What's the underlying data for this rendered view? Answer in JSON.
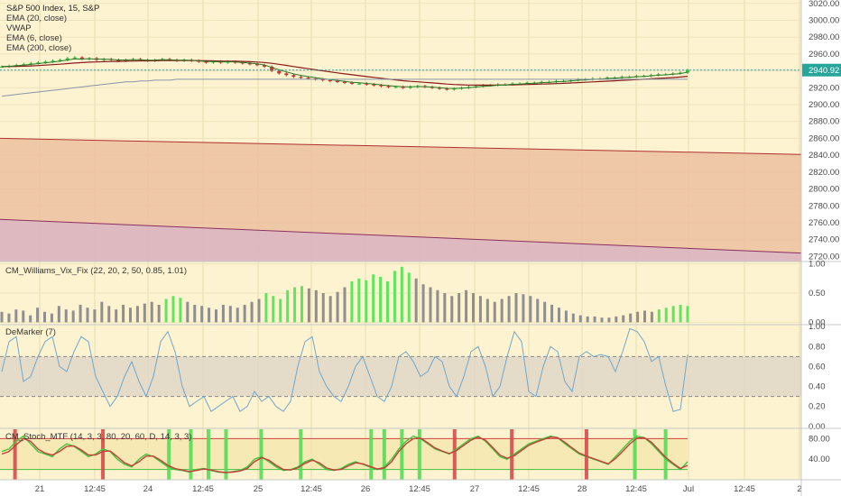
{
  "chart_data": [
    {
      "type": "candlestick",
      "title": "S&P 500 Index, 15, S&P",
      "indicators": [
        "EMA (20, close)",
        "VWAP",
        "EMA (6, close)",
        "EMA (200, close)"
      ],
      "y_ticks": [
        2720,
        2740,
        2760,
        2780,
        2800,
        2820,
        2840,
        2860,
        2880,
        2900,
        2920,
        2940,
        2960,
        2980,
        3000,
        3020
      ],
      "y_tick_labels": [
        "2720.00",
        "2740.00",
        "2760.00",
        "2780.00",
        "2800.00",
        "2820.00",
        "2840.00",
        "2860.00",
        "2880.00",
        "2900.00",
        "2920.00",
        "2940.00",
        "2960.00",
        "2980.00",
        "3000.00",
        "3020.00"
      ],
      "ylim": [
        2714,
        3024
      ],
      "last_price": 2940.92,
      "last_price_label": "2940.92",
      "close": [
        2945,
        2946,
        2947,
        2948,
        2949,
        2950,
        2951,
        2952,
        2953,
        2955,
        2956,
        2954,
        2955,
        2953,
        2954,
        2953,
        2952,
        2953,
        2954,
        2953,
        2952,
        2953,
        2954,
        2953,
        2952,
        2953,
        2952,
        2951,
        2950,
        2951,
        2950,
        2951,
        2950,
        2949,
        2948,
        2947,
        2945,
        2940,
        2937,
        2935,
        2933,
        2932,
        2931,
        2930,
        2929,
        2928,
        2927,
        2926,
        2925,
        2925,
        2924,
        2923,
        2922,
        2921,
        2921,
        2920,
        2921,
        2922,
        2921,
        2920,
        2919,
        2918,
        2919,
        2920,
        2921,
        2922,
        2923,
        2923,
        2924,
        2924,
        2925,
        2925,
        2926,
        2926,
        2927,
        2927,
        2928,
        2928,
        2929,
        2930,
        2930,
        2931,
        2931,
        2932,
        2932,
        2933,
        2933,
        2934,
        2934,
        2935,
        2936,
        2936,
        2937,
        2938,
        2941
      ],
      "ema200": [
        2910,
        2911,
        2912,
        2913,
        2914,
        2915,
        2916,
        2917,
        2918,
        2919,
        2920,
        2921,
        2922,
        2923,
        2924,
        2925,
        2926,
        2927,
        2927,
        2928,
        2928,
        2929,
        2929,
        2929,
        2930,
        2930,
        2930,
        2930,
        2930,
        2930,
        2930,
        2930,
        2930,
        2930,
        2930,
        2930,
        2930,
        2930,
        2930,
        2930,
        2930,
        2930,
        2930,
        2930,
        2930,
        2930,
        2930,
        2930,
        2930,
        2930,
        2930,
        2930,
        2930,
        2930,
        2930,
        2930,
        2930,
        2930,
        2930,
        2930,
        2930,
        2930,
        2930,
        2930,
        2930,
        2930,
        2930,
        2930,
        2930,
        2930,
        2930,
        2930,
        2930,
        2930,
        2930,
        2930,
        2930,
        2930,
        2930,
        2930,
        2930,
        2930,
        2930,
        2930,
        2930,
        2930,
        2930,
        2930,
        2930,
        2930,
        2930,
        2930,
        2930,
        2930,
        2930
      ],
      "channel_upper": {
        "start": 2860,
        "end": 2841
      },
      "channel_lower": {
        "start": 2764,
        "end": 2724
      }
    },
    {
      "type": "bar",
      "title": "CM_Williams_Vix_Fix (22, 20, 2, 50, 0.85, 1.01)",
      "y_ticks": [
        0,
        0.5,
        1
      ],
      "y_tick_labels": [
        "0.00",
        "0.50",
        "1.00"
      ],
      "ylim": [
        -0.04,
        1.04
      ],
      "values": [
        0.18,
        0.15,
        0.22,
        0.2,
        0.12,
        0.25,
        0.18,
        0.15,
        0.28,
        0.22,
        0.2,
        0.3,
        0.25,
        0.22,
        0.35,
        0.28,
        0.22,
        0.3,
        0.25,
        0.28,
        0.32,
        0.35,
        0.3,
        0.4,
        0.45,
        0.42,
        0.35,
        0.3,
        0.28,
        0.25,
        0.22,
        0.3,
        0.28,
        0.25,
        0.3,
        0.35,
        0.4,
        0.5,
        0.45,
        0.4,
        0.55,
        0.6,
        0.62,
        0.58,
        0.55,
        0.5,
        0.45,
        0.52,
        0.6,
        0.7,
        0.75,
        0.72,
        0.82,
        0.78,
        0.7,
        0.88,
        0.95,
        0.85,
        0.75,
        0.65,
        0.6,
        0.55,
        0.5,
        0.45,
        0.5,
        0.55,
        0.5,
        0.45,
        0.4,
        0.35,
        0.4,
        0.45,
        0.5,
        0.48,
        0.45,
        0.4,
        0.35,
        0.3,
        0.25,
        0.2,
        0.15,
        0.12,
        0.1,
        0.1,
        0.08,
        0.08,
        0.1,
        0.12,
        0.15,
        0.18,
        0.2,
        0.18,
        0.22,
        0.25,
        0.28,
        0.3,
        0.28
      ],
      "highlight": [
        false,
        false,
        false,
        false,
        false,
        false,
        false,
        false,
        false,
        false,
        false,
        false,
        false,
        false,
        false,
        false,
        false,
        false,
        false,
        false,
        false,
        false,
        false,
        true,
        true,
        true,
        false,
        false,
        false,
        false,
        false,
        false,
        false,
        false,
        false,
        false,
        false,
        true,
        true,
        true,
        true,
        true,
        true,
        false,
        false,
        false,
        false,
        false,
        false,
        true,
        true,
        true,
        true,
        true,
        true,
        true,
        true,
        true,
        false,
        false,
        false,
        false,
        false,
        false,
        false,
        false,
        false,
        false,
        false,
        false,
        false,
        false,
        false,
        false,
        false,
        false,
        false,
        false,
        false,
        false,
        false,
        false,
        false,
        false,
        false,
        false,
        false,
        false,
        false,
        false,
        false,
        false,
        true,
        true,
        true,
        true,
        true
      ]
    },
    {
      "type": "line",
      "title": "DeMarker (7)",
      "y_ticks": [
        0,
        0.2,
        0.4,
        0.6,
        0.8,
        1.0
      ],
      "y_tick_labels": [
        "0.00",
        "0.20",
        "0.40",
        "0.60",
        "0.80",
        "1.00"
      ],
      "ylim": [
        -0.02,
        1.02
      ],
      "band": [
        0.3,
        0.7
      ],
      "values": [
        0.55,
        0.85,
        0.9,
        0.45,
        0.5,
        0.7,
        0.85,
        0.9,
        0.6,
        0.55,
        0.75,
        0.9,
        0.85,
        0.5,
        0.35,
        0.2,
        0.3,
        0.5,
        0.65,
        0.45,
        0.3,
        0.5,
        0.85,
        0.95,
        0.75,
        0.4,
        0.2,
        0.25,
        0.3,
        0.15,
        0.2,
        0.25,
        0.3,
        0.15,
        0.2,
        0.35,
        0.25,
        0.3,
        0.2,
        0.15,
        0.25,
        0.6,
        0.85,
        0.9,
        0.55,
        0.4,
        0.3,
        0.25,
        0.4,
        0.6,
        0.7,
        0.5,
        0.3,
        0.25,
        0.4,
        0.7,
        0.75,
        0.65,
        0.5,
        0.55,
        0.7,
        0.65,
        0.4,
        0.3,
        0.5,
        0.75,
        0.8,
        0.6,
        0.3,
        0.4,
        0.7,
        0.95,
        0.85,
        0.35,
        0.3,
        0.6,
        0.8,
        0.75,
        0.45,
        0.35,
        0.7,
        0.75,
        0.7,
        0.72,
        0.7,
        0.55,
        0.75,
        0.98,
        0.95,
        0.85,
        0.65,
        0.7,
        0.4,
        0.15,
        0.17,
        0.72
      ]
    },
    {
      "type": "line",
      "title": "CM_Stoch_MTF (14, 3, 3, 80, 20, 60, D, 14, 3, 3)",
      "y_ticks": [
        40,
        80
      ],
      "y_tick_labels": [
        "40.00",
        "80.00"
      ],
      "ylim": [
        0,
        100
      ],
      "upper": 80,
      "lower": 20,
      "series": [
        {
          "values": [
            55,
            60,
            75,
            85,
            70,
            55,
            50,
            45,
            60,
            70,
            65,
            55,
            45,
            50,
            60,
            55,
            40,
            30,
            25,
            40,
            50,
            45,
            35,
            25,
            20,
            18,
            15,
            20,
            22,
            18,
            15,
            14,
            16,
            18,
            25,
            40,
            45,
            35,
            25,
            18,
            20,
            25,
            35,
            40,
            30,
            20,
            18,
            22,
            30,
            35,
            30,
            25,
            20,
            25,
            40,
            60,
            75,
            85,
            80,
            70,
            60,
            55,
            50,
            60,
            70,
            80,
            85,
            75,
            60,
            45,
            40,
            50,
            60,
            70,
            75,
            80,
            85,
            82,
            70,
            60,
            50,
            45,
            40,
            35,
            30,
            45,
            60,
            75,
            85,
            82,
            70,
            55,
            40,
            30,
            20,
            35
          ]
        },
        {
          "values": [
            50,
            55,
            68,
            80,
            75,
            60,
            52,
            48,
            55,
            65,
            66,
            58,
            48,
            48,
            55,
            56,
            45,
            33,
            27,
            35,
            46,
            46,
            38,
            28,
            22,
            19,
            16,
            18,
            21,
            19,
            16,
            14,
            15,
            17,
            22,
            35,
            43,
            38,
            28,
            20,
            19,
            23,
            32,
            38,
            33,
            23,
            19,
            20,
            27,
            33,
            31,
            26,
            21,
            23,
            35,
            55,
            70,
            80,
            81,
            72,
            62,
            56,
            51,
            57,
            67,
            77,
            83,
            77,
            63,
            48,
            42,
            47,
            57,
            67,
            73,
            78,
            83,
            82,
            73,
            62,
            52,
            46,
            41,
            36,
            31,
            41,
            55,
            70,
            81,
            82,
            73,
            58,
            43,
            32,
            22,
            28
          ]
        }
      ],
      "signals": [
        {
          "index": 3,
          "color": "red"
        },
        {
          "index": 23,
          "color": "red"
        },
        {
          "index": 38,
          "color": "green"
        },
        {
          "index": 43,
          "color": "green"
        },
        {
          "index": 47,
          "color": "green"
        },
        {
          "index": 51,
          "color": "green"
        },
        {
          "index": 59,
          "color": "green"
        },
        {
          "index": 68,
          "color": "green"
        },
        {
          "index": 84,
          "color": "green"
        },
        {
          "index": 87,
          "color": "green"
        },
        {
          "index": 91,
          "color": "green"
        },
        {
          "index": 95,
          "color": "green"
        },
        {
          "index": 103,
          "color": "red"
        },
        {
          "index": 116,
          "color": "red"
        },
        {
          "index": 133,
          "color": "red"
        },
        {
          "index": 144,
          "color": "green"
        },
        {
          "index": 151,
          "color": "green"
        }
      ]
    }
  ],
  "x_axis": {
    "tick_labels": [
      "21",
      "12:45",
      "24",
      "12:45",
      "25",
      "12:45",
      "26",
      "12:45",
      "27",
      "12:45",
      "28",
      "12:45",
      "Jul",
      "12:45",
      "2"
    ]
  }
}
